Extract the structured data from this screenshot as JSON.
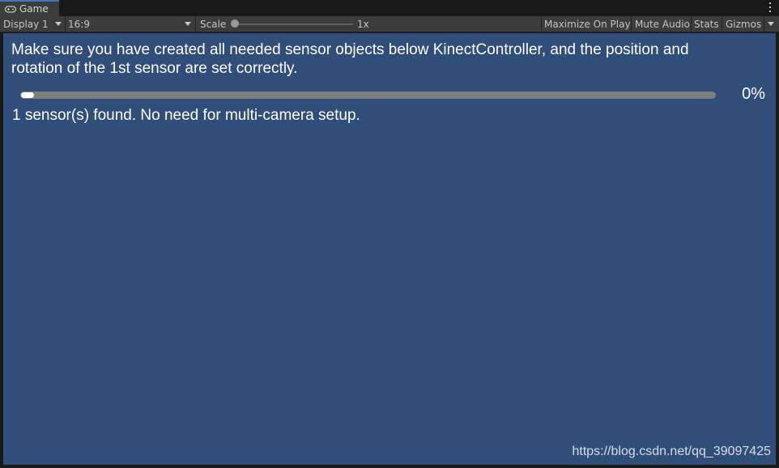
{
  "tab": {
    "title": "Game",
    "icon": "gamepad-icon"
  },
  "toolbar": {
    "display": "Display 1",
    "aspect": "16:9",
    "scale_label": "Scale",
    "scale_value": "1x",
    "maximize": "Maximize On Play",
    "mute": "Mute Audio",
    "stats": "Stats",
    "gizmos": "Gizmos"
  },
  "game": {
    "message": "Make sure you have created all needed sensor objects below KinectController, and the position and rotation of the 1st sensor are set correctly.",
    "progress_percent": 0,
    "progress_label": "0%",
    "status": "1 sensor(s) found. No need for multi-camera setup.",
    "watermark": "https://blog.csdn.net/qq_39097425"
  },
  "colors": {
    "game_bg": "#314d79",
    "tab_accent": "#3a79bb",
    "toolbar_bg": "#3c3c3c"
  }
}
